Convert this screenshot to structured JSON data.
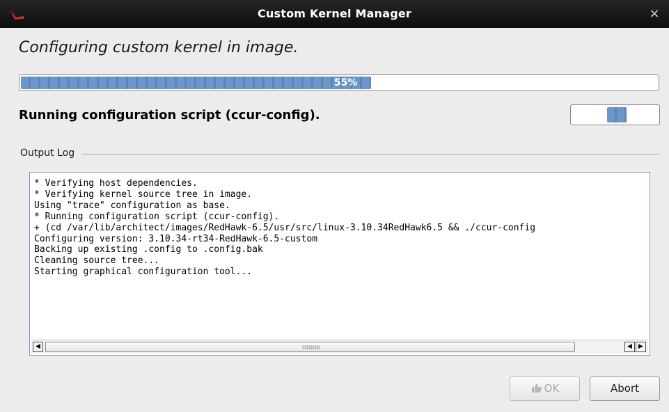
{
  "window": {
    "title": "Custom Kernel Manager",
    "close_glyph": "×",
    "app_icon": "redhawk-logo-icon"
  },
  "heading": "Configuring custom kernel in image.",
  "progress": {
    "value": 0.55,
    "label": "55%"
  },
  "status_line": "Running configuration script (ccur-config).",
  "output_log": {
    "label": "Output Log",
    "lines": [
      "* Verifying host dependencies.",
      "* Verifying kernel source tree in image.",
      "Using \"trace\" configuration as base.",
      "* Running configuration script (ccur-config).",
      "+ (cd /var/lib/architect/images/RedHawk-6.5/usr/src/linux-3.10.34RedHawk6.5 && ./ccur-config",
      "Configuring version: 3.10.34-rt34-RedHawk-6.5-custom",
      "Backing up existing .config to .config.bak",
      "Cleaning source tree...",
      "Starting graphical configuration tool..."
    ]
  },
  "buttons": {
    "ok_label": "OK",
    "abort_label": "Abort"
  },
  "colors": {
    "progress_fill": "#5e8cc0",
    "titlebar": "#1a1a1a"
  }
}
